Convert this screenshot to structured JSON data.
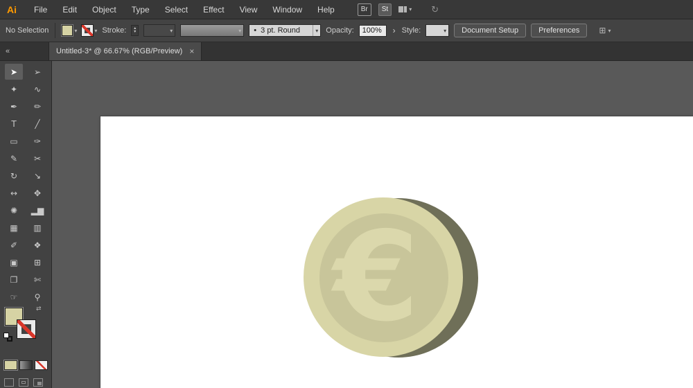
{
  "app": {
    "logo": "Ai"
  },
  "menubar": {
    "items": [
      "File",
      "Edit",
      "Object",
      "Type",
      "Select",
      "Effect",
      "View",
      "Window",
      "Help"
    ],
    "bridge": "Br",
    "stock": "St"
  },
  "controlbar": {
    "no_selection": "No Selection",
    "stroke_label": "Stroke:",
    "brush_bullet": "•",
    "brush_value": "3 pt. Round",
    "opacity_label": "Opacity:",
    "opacity_value": "100%",
    "style_label": "Style:",
    "document_setup": "Document Setup",
    "preferences": "Preferences"
  },
  "tabbar": {
    "collapse": "«",
    "title": "Untitled-3* @ 66.67% (RGB/Preview)",
    "close": "×"
  },
  "tools": {
    "items": [
      {
        "name": "selection-tool",
        "glyph": "➤",
        "selected": true
      },
      {
        "name": "direct-selection-tool",
        "glyph": "➢"
      },
      {
        "name": "magic-wand-tool",
        "glyph": "✦"
      },
      {
        "name": "lasso-tool",
        "glyph": "∿"
      },
      {
        "name": "pen-tool",
        "glyph": "✒"
      },
      {
        "name": "blob-brush-tool",
        "glyph": "✏"
      },
      {
        "name": "type-tool",
        "glyph": "T"
      },
      {
        "name": "line-segment-tool",
        "glyph": "╱"
      },
      {
        "name": "rectangle-tool",
        "glyph": "▭"
      },
      {
        "name": "paintbrush-tool",
        "glyph": "✑"
      },
      {
        "name": "pencil-tool",
        "glyph": "✎"
      },
      {
        "name": "scissors-tool",
        "glyph": "✂"
      },
      {
        "name": "rotate-tool",
        "glyph": "↻"
      },
      {
        "name": "scale-tool",
        "glyph": "↘"
      },
      {
        "name": "width-tool",
        "glyph": "↔"
      },
      {
        "name": "free-transform-tool",
        "glyph": "✥"
      },
      {
        "name": "symbol-sprayer-tool",
        "glyph": "✺"
      },
      {
        "name": "column-graph-tool",
        "glyph": "▂▆"
      },
      {
        "name": "mesh-tool",
        "glyph": "▦"
      },
      {
        "name": "gradient-tool",
        "glyph": "▥"
      },
      {
        "name": "eyedropper-tool",
        "glyph": "✐"
      },
      {
        "name": "blend-tool",
        "glyph": "❖"
      },
      {
        "name": "live-paint-bucket-tool",
        "glyph": "▣"
      },
      {
        "name": "perspective-grid-tool",
        "glyph": "⊞"
      },
      {
        "name": "artboard-tool",
        "glyph": "❐"
      },
      {
        "name": "slice-tool",
        "glyph": "✄"
      },
      {
        "name": "hand-tool",
        "glyph": "☞"
      },
      {
        "name": "zoom-tool",
        "glyph": "⚲"
      }
    ]
  },
  "glyphs": {
    "chevron": "▾",
    "up": "▴",
    "down": "▾",
    "disclose": "›",
    "swap": "⇄",
    "sync": "↻",
    "align_icon": "⊞"
  },
  "canvas": {
    "coin": {
      "symbol": "€"
    }
  },
  "colors": {
    "logo_orange": "#ff9a00",
    "fill_swatch": "#d6d3a4",
    "none_red": "#d8362a",
    "coin_face": "#d8d5a6",
    "coin_side": "#6f6f58",
    "coin_inner": "#c8c59a",
    "euro_symbol": "#dbd8ac"
  }
}
